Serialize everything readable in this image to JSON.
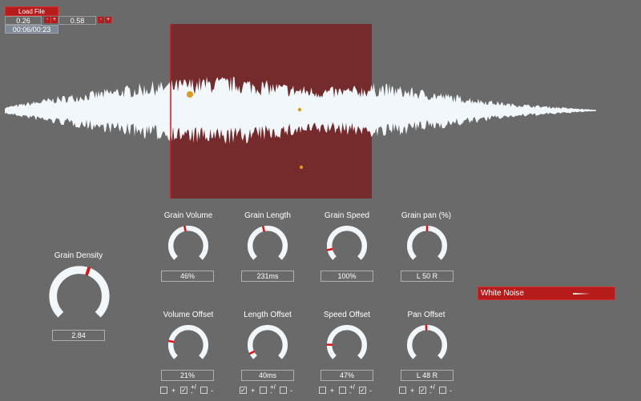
{
  "toolbar": {
    "load_label": "Load File",
    "start_value": "0.26",
    "end_value": "0.58",
    "minus": "-",
    "plus": "+",
    "time": "00:06/00:23"
  },
  "colors": {
    "background": "#6a6a6a",
    "accent_red": "#b71c1c",
    "selection": "#752b2b",
    "waveform": "#f1f7fb",
    "marker": "#e09a1a"
  },
  "selection": {
    "start_fraction": 0.26,
    "end_fraction": 0.58
  },
  "knobs": [
    {
      "id": "grain-volume",
      "label": "Grain Volume",
      "value": "46%",
      "level": 0.46
    },
    {
      "id": "grain-length",
      "label": "Grain Length",
      "value": "231ms",
      "level": 0.45
    },
    {
      "id": "grain-speed",
      "label": "Grain Speed",
      "value": "100%",
      "level": 0.12
    },
    {
      "id": "grain-pan",
      "label": "Grain pan (%)",
      "value": "L 50 R",
      "level": 0.5
    },
    {
      "id": "grain-density",
      "label": "Grain Density",
      "value": "2.84",
      "level": 0.57
    },
    {
      "id": "volume-offset",
      "label": "Volume Offset",
      "value": "21%",
      "level": 0.21
    },
    {
      "id": "length-offset",
      "label": "Length Offset",
      "value": "40ms",
      "level": 0.07
    },
    {
      "id": "speed-offset",
      "label": "Speed Offset",
      "value": "47%",
      "level": 0.17
    },
    {
      "id": "pan-offset",
      "label": "Pan Offset",
      "value": "L 48 R",
      "level": 0.49
    }
  ],
  "offset_toggles": [
    {
      "plus": "+",
      "both": "+/-",
      "minus": "-",
      "checked": [
        false,
        true,
        false
      ]
    },
    {
      "plus": "+",
      "both": "+/-",
      "minus": "-",
      "checked": [
        true,
        false,
        false
      ]
    },
    {
      "plus": "+",
      "both": "+/-",
      "minus": "-",
      "checked": [
        false,
        false,
        true
      ]
    },
    {
      "plus": "+",
      "both": "+/-",
      "minus": "-",
      "checked": [
        false,
        true,
        false
      ]
    }
  ],
  "noise_select": {
    "label": "White Noise",
    "icon": "dropdown-arrow-icon"
  }
}
